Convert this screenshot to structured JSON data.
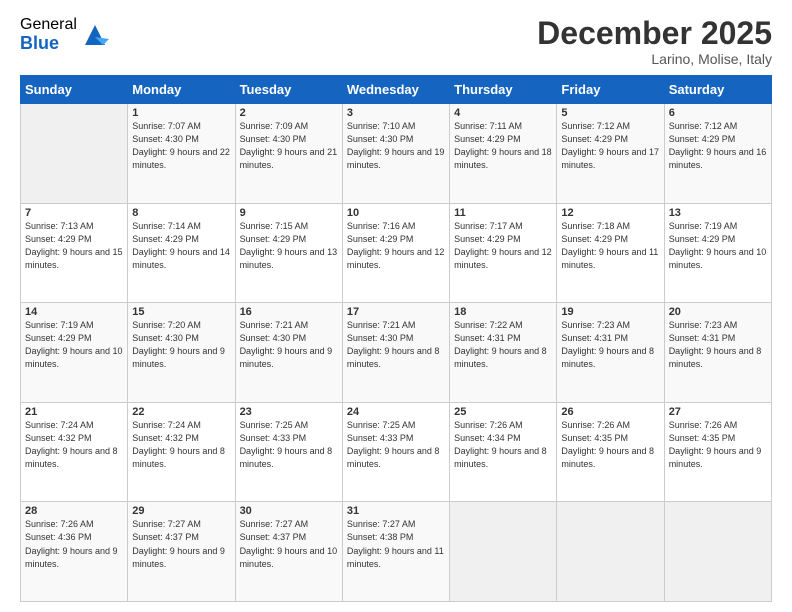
{
  "logo": {
    "general": "General",
    "blue": "Blue"
  },
  "header": {
    "month": "December 2025",
    "location": "Larino, Molise, Italy"
  },
  "weekdays": [
    "Sunday",
    "Monday",
    "Tuesday",
    "Wednesday",
    "Thursday",
    "Friday",
    "Saturday"
  ],
  "weeks": [
    [
      {
        "day": null
      },
      {
        "day": "1",
        "sunrise": "7:07 AM",
        "sunset": "4:30 PM",
        "daylight": "9 hours and 22 minutes."
      },
      {
        "day": "2",
        "sunrise": "7:09 AM",
        "sunset": "4:30 PM",
        "daylight": "9 hours and 21 minutes."
      },
      {
        "day": "3",
        "sunrise": "7:10 AM",
        "sunset": "4:30 PM",
        "daylight": "9 hours and 19 minutes."
      },
      {
        "day": "4",
        "sunrise": "7:11 AM",
        "sunset": "4:29 PM",
        "daylight": "9 hours and 18 minutes."
      },
      {
        "day": "5",
        "sunrise": "7:12 AM",
        "sunset": "4:29 PM",
        "daylight": "9 hours and 17 minutes."
      },
      {
        "day": "6",
        "sunrise": "7:12 AM",
        "sunset": "4:29 PM",
        "daylight": "9 hours and 16 minutes."
      }
    ],
    [
      {
        "day": "7",
        "sunrise": "7:13 AM",
        "sunset": "4:29 PM",
        "daylight": "9 hours and 15 minutes."
      },
      {
        "day": "8",
        "sunrise": "7:14 AM",
        "sunset": "4:29 PM",
        "daylight": "9 hours and 14 minutes."
      },
      {
        "day": "9",
        "sunrise": "7:15 AM",
        "sunset": "4:29 PM",
        "daylight": "9 hours and 13 minutes."
      },
      {
        "day": "10",
        "sunrise": "7:16 AM",
        "sunset": "4:29 PM",
        "daylight": "9 hours and 12 minutes."
      },
      {
        "day": "11",
        "sunrise": "7:17 AM",
        "sunset": "4:29 PM",
        "daylight": "9 hours and 12 minutes."
      },
      {
        "day": "12",
        "sunrise": "7:18 AM",
        "sunset": "4:29 PM",
        "daylight": "9 hours and 11 minutes."
      },
      {
        "day": "13",
        "sunrise": "7:19 AM",
        "sunset": "4:29 PM",
        "daylight": "9 hours and 10 minutes."
      }
    ],
    [
      {
        "day": "14",
        "sunrise": "7:19 AM",
        "sunset": "4:29 PM",
        "daylight": "9 hours and 10 minutes."
      },
      {
        "day": "15",
        "sunrise": "7:20 AM",
        "sunset": "4:30 PM",
        "daylight": "9 hours and 9 minutes."
      },
      {
        "day": "16",
        "sunrise": "7:21 AM",
        "sunset": "4:30 PM",
        "daylight": "9 hours and 9 minutes."
      },
      {
        "day": "17",
        "sunrise": "7:21 AM",
        "sunset": "4:30 PM",
        "daylight": "9 hours and 8 minutes."
      },
      {
        "day": "18",
        "sunrise": "7:22 AM",
        "sunset": "4:31 PM",
        "daylight": "9 hours and 8 minutes."
      },
      {
        "day": "19",
        "sunrise": "7:23 AM",
        "sunset": "4:31 PM",
        "daylight": "9 hours and 8 minutes."
      },
      {
        "day": "20",
        "sunrise": "7:23 AM",
        "sunset": "4:31 PM",
        "daylight": "9 hours and 8 minutes."
      }
    ],
    [
      {
        "day": "21",
        "sunrise": "7:24 AM",
        "sunset": "4:32 PM",
        "daylight": "9 hours and 8 minutes."
      },
      {
        "day": "22",
        "sunrise": "7:24 AM",
        "sunset": "4:32 PM",
        "daylight": "9 hours and 8 minutes."
      },
      {
        "day": "23",
        "sunrise": "7:25 AM",
        "sunset": "4:33 PM",
        "daylight": "9 hours and 8 minutes."
      },
      {
        "day": "24",
        "sunrise": "7:25 AM",
        "sunset": "4:33 PM",
        "daylight": "9 hours and 8 minutes."
      },
      {
        "day": "25",
        "sunrise": "7:26 AM",
        "sunset": "4:34 PM",
        "daylight": "9 hours and 8 minutes."
      },
      {
        "day": "26",
        "sunrise": "7:26 AM",
        "sunset": "4:35 PM",
        "daylight": "9 hours and 8 minutes."
      },
      {
        "day": "27",
        "sunrise": "7:26 AM",
        "sunset": "4:35 PM",
        "daylight": "9 hours and 9 minutes."
      }
    ],
    [
      {
        "day": "28",
        "sunrise": "7:26 AM",
        "sunset": "4:36 PM",
        "daylight": "9 hours and 9 minutes."
      },
      {
        "day": "29",
        "sunrise": "7:27 AM",
        "sunset": "4:37 PM",
        "daylight": "9 hours and 9 minutes."
      },
      {
        "day": "30",
        "sunrise": "7:27 AM",
        "sunset": "4:37 PM",
        "daylight": "9 hours and 10 minutes."
      },
      {
        "day": "31",
        "sunrise": "7:27 AM",
        "sunset": "4:38 PM",
        "daylight": "9 hours and 11 minutes."
      },
      {
        "day": null
      },
      {
        "day": null
      },
      {
        "day": null
      }
    ]
  ],
  "labels": {
    "sunrise": "Sunrise:",
    "sunset": "Sunset:",
    "daylight": "Daylight:"
  }
}
